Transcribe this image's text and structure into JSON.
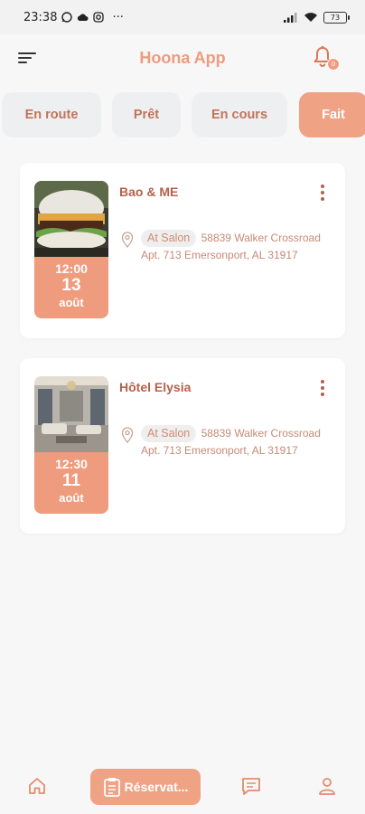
{
  "status_bar": {
    "time": "23:38",
    "extra": "···",
    "battery": "73"
  },
  "header": {
    "title": "Hoona App",
    "notification_count": "0"
  },
  "tabs": [
    {
      "label": "En route",
      "active": false
    },
    {
      "label": "Prêt",
      "active": false
    },
    {
      "label": "En cours",
      "active": false
    },
    {
      "label": "Fait",
      "active": true
    }
  ],
  "reservations": [
    {
      "name": "Bao & ME",
      "time": "12:00",
      "day": "13",
      "month": "août",
      "type": "At Salon",
      "address": "58839 Walker Crossroad Apt. 713 Emersonport, AL 31917"
    },
    {
      "name": "Hôtel Elysia",
      "time": "12:30",
      "day": "11",
      "month": "août",
      "type": "At Salon",
      "address": "58839 Walker Crossroad Apt. 713 Emersonport, AL 31917"
    }
  ],
  "bottom_nav": {
    "active_label": "Réservat..."
  },
  "colors": {
    "accent": "#ef9b7d",
    "accent_dark": "#b5614a",
    "background": "#f7f7f8"
  }
}
